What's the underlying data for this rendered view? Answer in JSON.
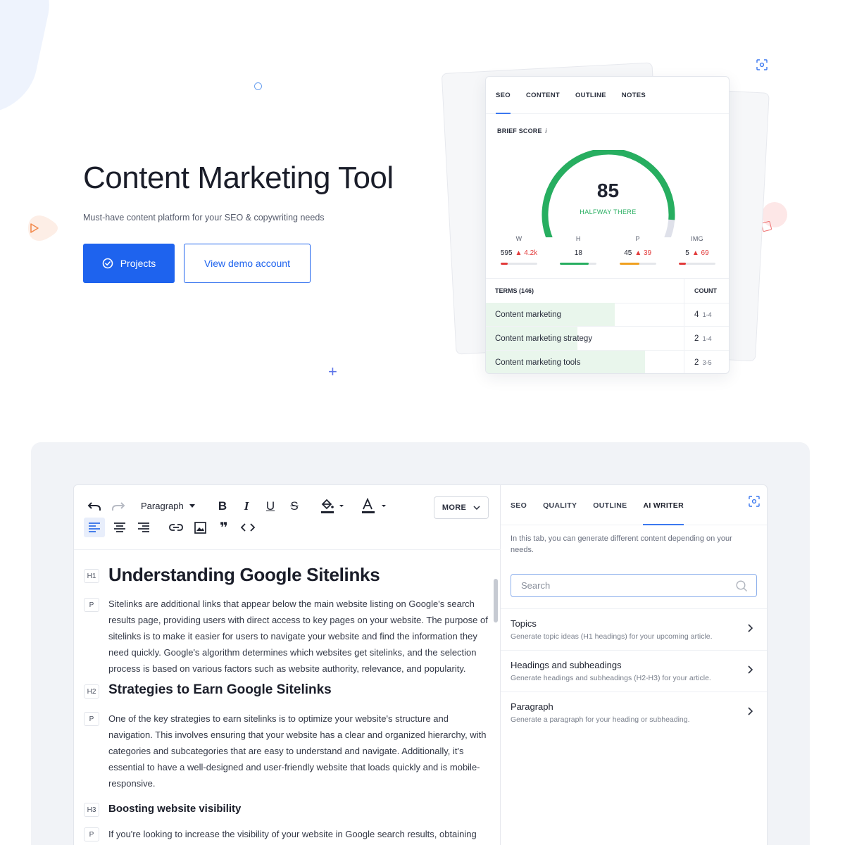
{
  "hero": {
    "title": "Content Marketing Tool",
    "subtitle": "Must-have content platform for your SEO & copywriting needs",
    "primary_button": "Projects",
    "secondary_button": "View demo account"
  },
  "seo_card": {
    "tabs": [
      "SEO",
      "CONTENT",
      "OUTLINE",
      "NOTES"
    ],
    "active_tab": "SEO",
    "brief_label": "BRIEF SCORE",
    "info_glyph": "i",
    "score": "85",
    "score_fraction": 0.85,
    "score_caption": "HALFWAY THERE",
    "metrics": [
      {
        "label": "W",
        "value": "595",
        "delta": "4.2k",
        "fill": 0.2,
        "color": "#e23a3a"
      },
      {
        "label": "H",
        "value": "18",
        "delta": "",
        "fill": 0.78,
        "color": "#27ae60"
      },
      {
        "label": "P",
        "value": "45",
        "delta": "39",
        "fill": 0.55,
        "color": "#f0a020"
      },
      {
        "label": "IMG",
        "value": "5",
        "delta": "69",
        "fill": 0.2,
        "color": "#e23a3a"
      }
    ],
    "terms_header": "TERMS (146)",
    "count_header": "COUNT",
    "terms": [
      {
        "name": "Content marketing",
        "count": "4",
        "range": "1-4",
        "fill": 0.65
      },
      {
        "name": "Content marketing strategy",
        "count": "2",
        "range": "1-4",
        "fill": 0.46
      },
      {
        "name": "Content marketing tools",
        "count": "2",
        "range": "3-5",
        "fill": 0.8
      }
    ]
  },
  "editor": {
    "toolbar": {
      "block_type": "Paragraph",
      "more_label": "MORE"
    },
    "blocks": [
      {
        "tag": "H1",
        "text": "Understanding Google Sitelinks"
      },
      {
        "tag": "P",
        "text": "Sitelinks are additional links that appear below the main website listing on Google's search results page, providing users with direct access to key pages on your website. The purpose of sitelinks is to make it easier for users to navigate your website and find the information they need quickly. Google's algorithm determines which websites get sitelinks, and the selection process is based on various factors such as website authority, relevance, and popularity."
      },
      {
        "tag": "H2",
        "text": "Strategies to Earn Google Sitelinks"
      },
      {
        "tag": "P",
        "text": "One of the key strategies to earn sitelinks is to optimize your website's structure and navigation. This involves ensuring that your website has a clear and organized hierarchy, with categories and subcategories that are easy to understand and navigate. Additionally, it's essential to have a well-designed and user-friendly website that loads quickly and is mobile-responsive."
      },
      {
        "tag": "H3",
        "text": "Boosting website visibility"
      },
      {
        "tag": "P",
        "text": "If you're looking to increase the visibility of your website in Google search results, obtaining"
      }
    ]
  },
  "ai_panel": {
    "tabs": [
      "SEO",
      "QUALITY",
      "OUTLINE",
      "AI WRITER"
    ],
    "active_tab": "AI WRITER",
    "description": "In this tab, you can generate different content depending on your needs.",
    "search_placeholder": "Search",
    "items": [
      {
        "title": "Topics",
        "description": "Generate topic ideas (H1 headings) for your upcoming article."
      },
      {
        "title": "Headings and subheadings",
        "description": "Generate headings and subheadings (H2-H3) for your article."
      },
      {
        "title": "Paragraph",
        "description": "Generate a paragraph for your heading or subheading."
      }
    ]
  },
  "colors": {
    "accent": "#1e63ee",
    "success": "#27ae60",
    "warning": "#f0a020",
    "danger": "#e23a3a"
  },
  "icons": [
    "check-circle-icon",
    "scan-icon",
    "undo-icon",
    "redo-icon",
    "bold-icon",
    "italic-icon",
    "underline-icon",
    "strikethrough-icon",
    "fill-color-icon",
    "text-color-icon",
    "align-left-icon",
    "align-center-icon",
    "align-right-icon",
    "link-icon",
    "image-icon",
    "quote-icon",
    "code-icon",
    "chevron-down-icon",
    "search-icon",
    "chevron-right-icon"
  ]
}
